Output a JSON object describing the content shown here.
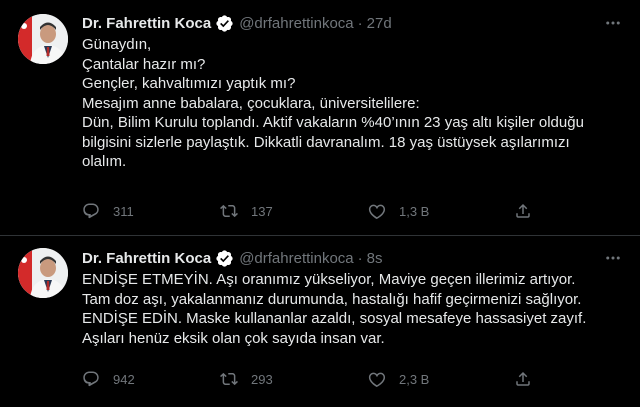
{
  "tweets": [
    {
      "author": {
        "name": "Dr. Fahrettin Koca",
        "handle": "@drfahrettinkoca",
        "time": "27d"
      },
      "lines": [
        "Günaydın,",
        "Çantalar hazır mı?",
        "Gençler, kahvaltımızı yaptık mı?",
        "Mesajım anne babalara, çocuklara, üniversitelilere:",
        "Dün, Bilim Kurulu toplandı. Aktif vakaların %40’ının 23 yaş altı kişiler olduğu",
        "bilgisini sizlerle paylaştık. Dikkatli davranalım. 18 yaş üstüysek aşılarımızı",
        "olalım."
      ],
      "stats": {
        "replies": "311",
        "retweets": "137",
        "likes": "1,3 B"
      }
    },
    {
      "author": {
        "name": "Dr. Fahrettin Koca",
        "handle": "@drfahrettinkoca",
        "time": "8s"
      },
      "lines": [
        "ENDİŞE ETMEYİN. Aşı oranımız yükseliyor, Maviye geçen illerimiz artıyor.",
        "Tam doz aşı, yakalanmanız durumunda, hastalığı hafif geçirmenizi sağlıyor.",
        "ENDİŞE EDİN. Maske kullananlar azaldı, sosyal mesafeye hassasiyet zayıf.",
        "Aşıları henüz eksik olan çok sayıda insan var."
      ],
      "stats": {
        "replies": "942",
        "retweets": "293",
        "likes": "2,3 B"
      }
    }
  ],
  "icons": {
    "more": "more-icon",
    "verified": "verified-badge-icon",
    "reply": "reply-icon",
    "retweet": "retweet-icon",
    "like": "like-icon",
    "share": "share-icon"
  },
  "colors": {
    "background": "#000000",
    "text": "#e7e9ea",
    "muted": "#71767b",
    "divider": "#2f3336",
    "verified": "#ffffff"
  }
}
